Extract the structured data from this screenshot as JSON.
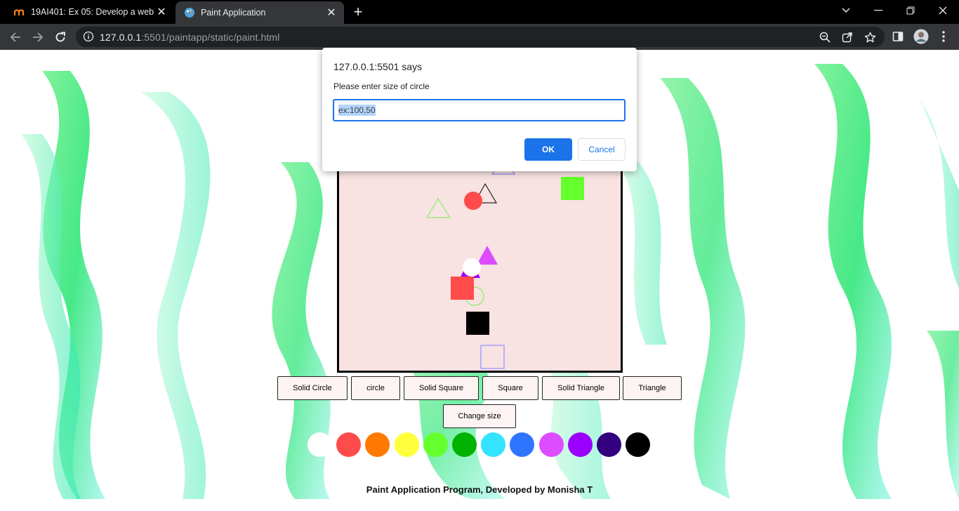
{
  "browser": {
    "tabs": [
      {
        "title": "19AI401: Ex 05: Develop a webpa",
        "active": false,
        "icon": "moodle-icon"
      },
      {
        "title": "Paint Application",
        "active": true,
        "icon": "paint-palette-icon"
      }
    ],
    "url_host": "127.0.0.1",
    "url_rest": ":5501/paintapp/static/paint.html"
  },
  "dialog": {
    "title": "127.0.0.1:5501 says",
    "message": "Please enter size of circle",
    "input_value": "ex:100,50",
    "ok_label": "OK",
    "cancel_label": "Cancel"
  },
  "canvas": {
    "background": "#f8e2e2"
  },
  "buttons": [
    {
      "label": "Solid Circle",
      "name": "solid-circle-button"
    },
    {
      "label": "circle",
      "name": "circle-button"
    },
    {
      "label": "Solid Square",
      "name": "solid-square-button"
    },
    {
      "label": "Square",
      "name": "square-button"
    },
    {
      "label": "Solid Triangle",
      "name": "solid-triangle-button"
    },
    {
      "label": "Triangle",
      "name": "triangle-button"
    },
    {
      "label": "Change size",
      "name": "change-size-button"
    }
  ],
  "palette": [
    "#ffffff",
    "#ff4b4b",
    "#ff7a00",
    "#ffff3b",
    "#66ff2e",
    "#00b300",
    "#33e3ff",
    "#2f74ff",
    "#dd4dff",
    "#9b00ff",
    "#33007f",
    "#000000"
  ],
  "footer": "Paint Application Program, Developed by Monisha T"
}
